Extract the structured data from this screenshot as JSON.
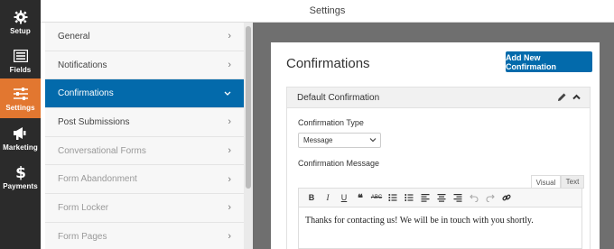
{
  "rail": {
    "items": [
      {
        "label": "Setup",
        "icon": "gear-icon"
      },
      {
        "label": "Fields",
        "icon": "fields-icon"
      },
      {
        "label": "Settings",
        "icon": "sliders-icon",
        "active": true
      },
      {
        "label": "Marketing",
        "icon": "megaphone-icon"
      },
      {
        "label": "Payments",
        "icon": "dollar-icon"
      }
    ],
    "active_color": "#e27730"
  },
  "header": {
    "title": "Settings"
  },
  "nav": {
    "items": [
      {
        "label": "General"
      },
      {
        "label": "Notifications"
      },
      {
        "label": "Confirmations",
        "active": true
      },
      {
        "label": "Post Submissions"
      },
      {
        "label": "Conversational Forms",
        "dim": true
      },
      {
        "label": "Form Abandonment",
        "dim": true
      },
      {
        "label": "Form Locker",
        "dim": true
      },
      {
        "label": "Form Pages",
        "dim": true
      }
    ],
    "active_color": "#036aab"
  },
  "main": {
    "title": "Confirmations",
    "add_button": "Add New Confirmation",
    "confirmation": {
      "header": "Default Confirmation",
      "type_label": "Confirmation Type",
      "type_value": "Message",
      "message_label": "Confirmation Message",
      "tabs": {
        "visual": "Visual",
        "text": "Text"
      },
      "editor_text": "Thanks for contacting us! We will be in touch with you shortly."
    },
    "toolbar": {
      "bold": "B",
      "italic": "I",
      "underline": "U",
      "quote": "❝",
      "strike": "ABC"
    }
  }
}
